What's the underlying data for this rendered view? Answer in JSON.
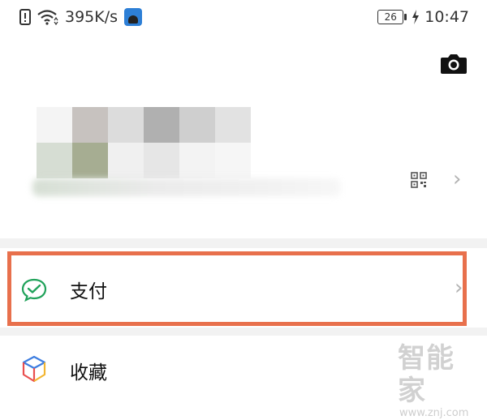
{
  "status_bar": {
    "net_speed": "395K/s",
    "battery_level": "26",
    "time": "10:47",
    "icons": [
      "alert-icon",
      "wifi-icon",
      "app-notification-icon",
      "charging-icon"
    ]
  },
  "header": {
    "camera_icon": "camera-icon"
  },
  "profile": {
    "qr_icon": "qr-code-icon",
    "chevron": "›"
  },
  "menu": {
    "pay_label": "支付",
    "pay_chevron": "›",
    "favorites_label": "收藏"
  },
  "watermark": {
    "title": "智能家",
    "url": "www.znj.com"
  },
  "colors": {
    "highlight": "#e8704c",
    "pay_green": "#20a25a",
    "background": "#ffffff",
    "separator": "#f2f2f2"
  }
}
